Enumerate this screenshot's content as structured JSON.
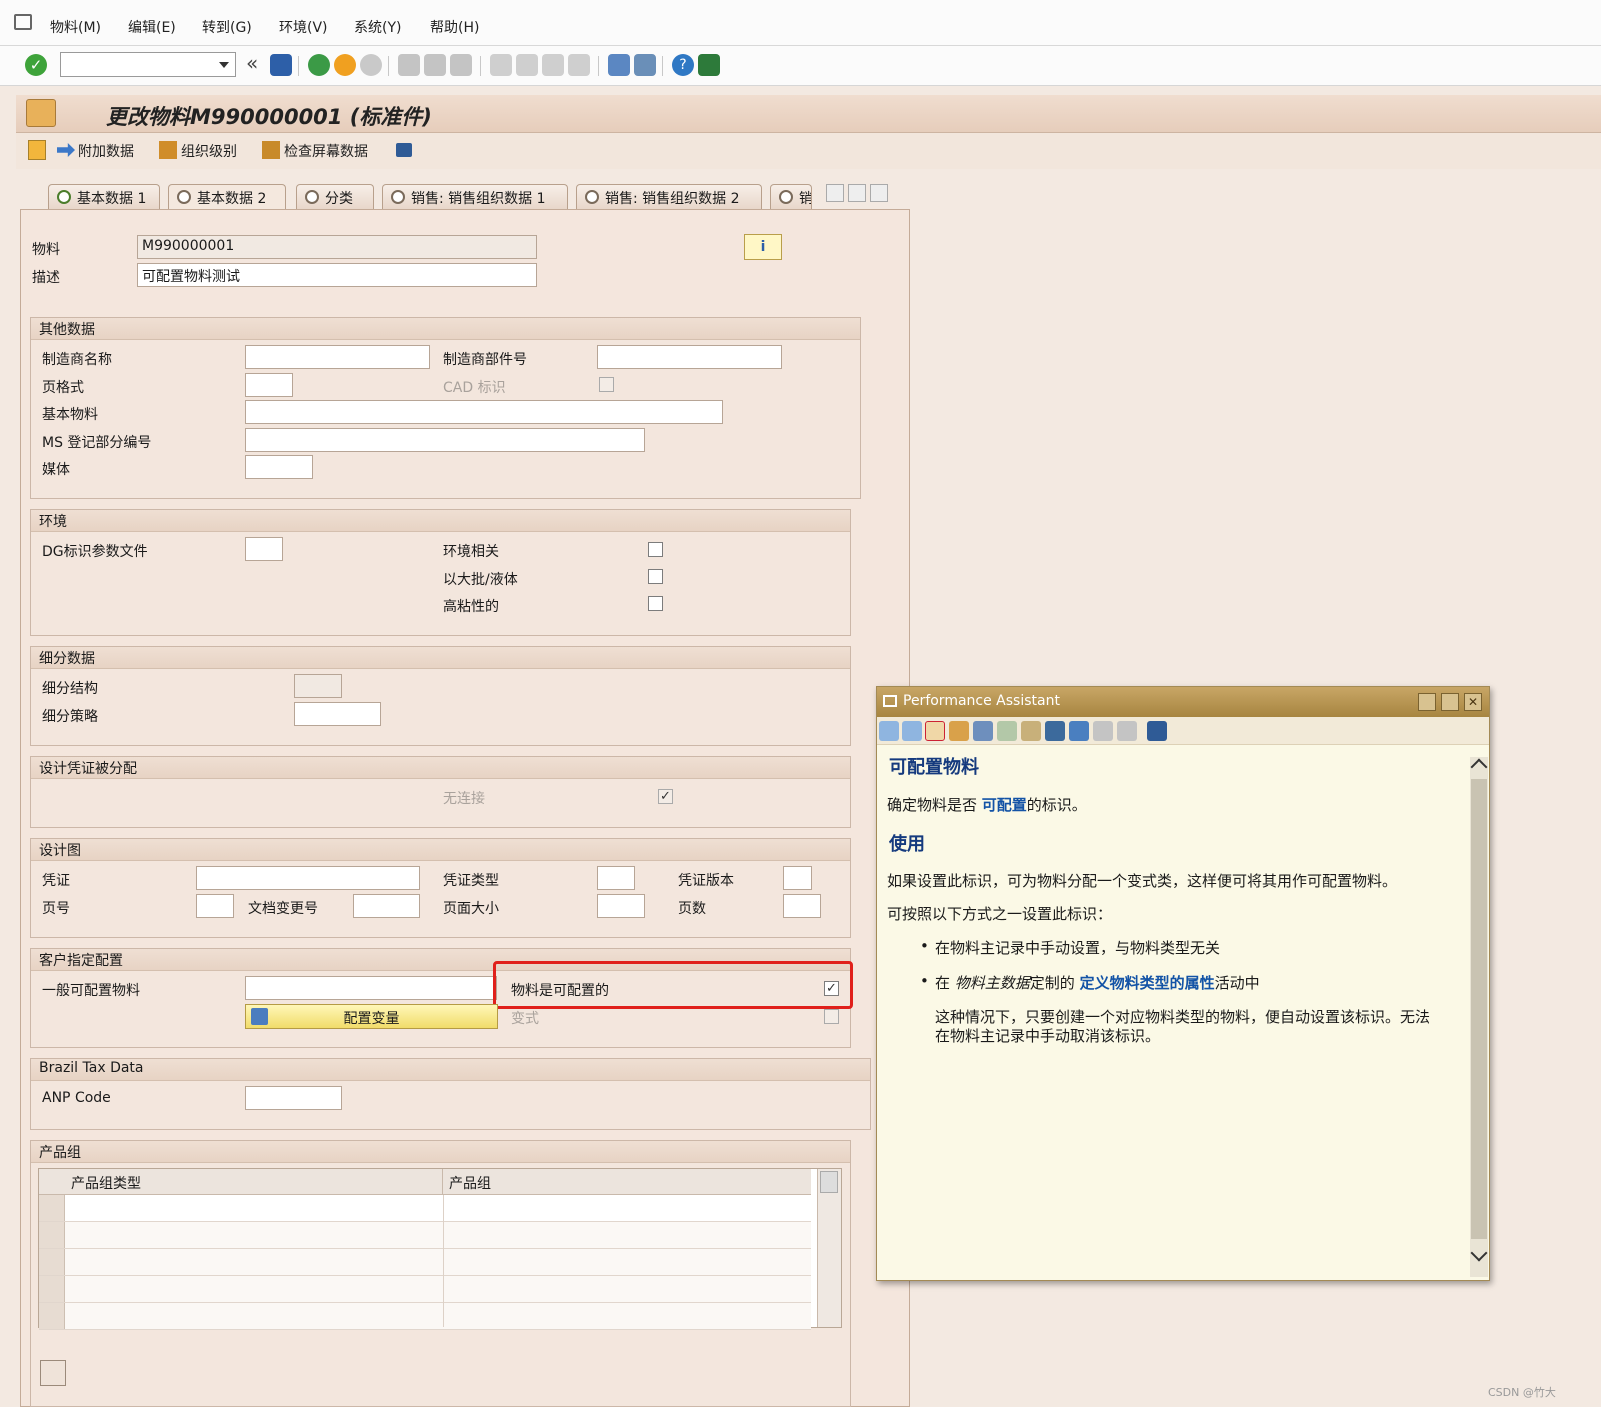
{
  "menu": {
    "items": [
      "物料(M)",
      "编辑(E)",
      "转到(G)",
      "环境(V)",
      "系统(Y)",
      "帮助(H)"
    ]
  },
  "toolbar": {
    "command_field": "",
    "back_glyph": "«"
  },
  "title": {
    "text": "更改物料M990000001 (标准件)"
  },
  "app_toolbar": {
    "additional_data": "附加数据",
    "org_levels": "组织级别",
    "check_screen_data": "检查屏幕数据"
  },
  "tabs": [
    "基本数据 1",
    "基本数据 2",
    "分类",
    "销售: 销售组织数据 1",
    "销售: 销售组织数据 2",
    "销"
  ],
  "header": {
    "material_label": "物料",
    "material_value": "M990000001",
    "description_label": "描述",
    "description_value": "可配置物料测试"
  },
  "other_data": {
    "title": "其他数据",
    "manufacturer_name": "制造商名称",
    "manufacturer_part": "制造商部件号",
    "page_format": "页格式",
    "cad_indicator": "CAD 标识",
    "basic_material": "基本物料",
    "ms_book_part": "MS 登记部分编号",
    "medium": "媒体"
  },
  "environment": {
    "title": "环境",
    "dg_profile": "DG标识参数文件",
    "env_relevant": "环境相关",
    "bulk_liquid": "以大批/液体",
    "high_viscous": "高粘性的"
  },
  "segmentation": {
    "title": "细分数据",
    "structure": "细分结构",
    "strategy": "细分策略"
  },
  "design_doc": {
    "title": "设计凭证被分配",
    "no_link": "无连接",
    "no_link_checked": true
  },
  "drawing": {
    "title": "设计图",
    "document": "凭证",
    "doc_type": "凭证类型",
    "doc_version": "凭证版本",
    "page_number": "页号",
    "doc_change_no": "文档变更号",
    "page_size": "页面大小",
    "sheets": "页数"
  },
  "config": {
    "title": "客户指定配置",
    "general_configurable": "一般可配置物料",
    "is_configurable": "物料是可配置的",
    "is_configurable_checked": true,
    "config_variant_button": "配置变量",
    "variant": "变式",
    "highlight_color": "#e0201b"
  },
  "brazil": {
    "title": "Brazil Tax Data",
    "anp_code": "ANP Code"
  },
  "product_group": {
    "title": "产品组",
    "columns": [
      "产品组类型",
      "产品组"
    ],
    "rows": 5
  },
  "pa": {
    "window_title": "Performance Assistant",
    "heading": "可配置物料",
    "line1_prefix": "确定物料是否 ",
    "line1_link": "可配置",
    "line1_suffix": "的标识。",
    "usage_heading": "使用",
    "para1": "如果设置此标识，可为物料分配一个变式类，这样便可将其用作可配置物料。",
    "para2": "可按照以下方式之一设置此标识：",
    "bullet1": "在物料主记录中手动设置，与物料类型无关",
    "bullet2_prefix": "在 ",
    "bullet2_italic": "物料主数据",
    "bullet2_mid": "定制的 ",
    "bullet2_link": "定义物料类型的属性",
    "bullet2_suffix": "活动中",
    "note_line1": "这种情况下，只要创建一个对应物料类型的物料，便自动设置该标识。无法",
    "note_line2": "在物料主记录中手动取消该标识。"
  },
  "watermark": "CSDN @竹大"
}
